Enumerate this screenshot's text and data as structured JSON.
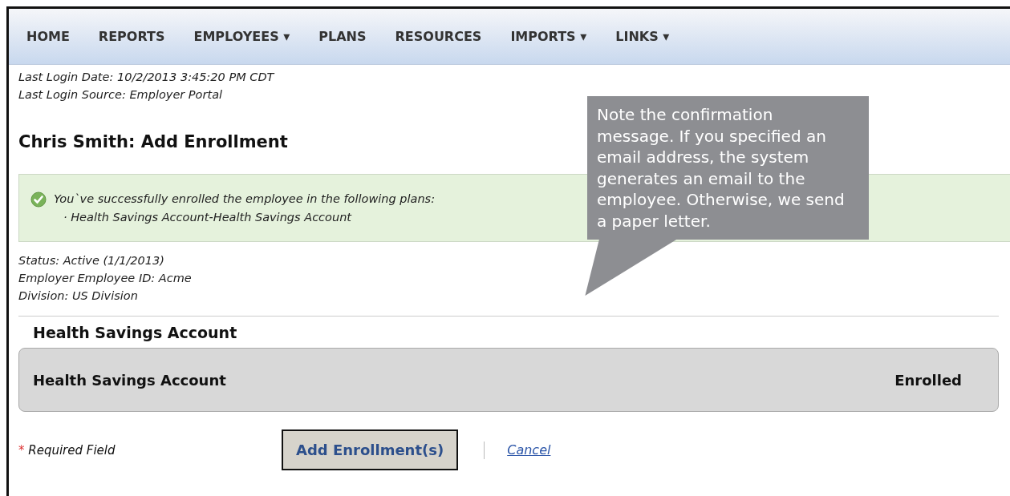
{
  "nav": [
    {
      "label": "HOME"
    },
    {
      "label": "REPORTS"
    },
    {
      "label": "EMPLOYEES",
      "arrow": "▾"
    },
    {
      "label": "PLANS"
    },
    {
      "label": "RESOURCES"
    },
    {
      "label": "IMPORTS",
      "arrow": "▾"
    },
    {
      "label": "LINKS",
      "arrow": "▾"
    }
  ],
  "login": [
    "Last Login Date: 10/2/2013 3:45:20 PM CDT",
    "Last Login Source: Employer Portal"
  ],
  "heading": "Chris Smith: Add Enrollment",
  "success": {
    "message": "You`ve successfully enrolled the employee in the following plans:",
    "items": [
      "· Health Savings Account-Health Savings Account"
    ]
  },
  "details": [
    "Status: Active (1/1/2013)",
    "Employer Employee ID: Acme",
    "Division: US Division"
  ],
  "section": {
    "title": "Health Savings Account",
    "plan": {
      "name": "Health Savings Account",
      "status": "Enrolled"
    }
  },
  "footer": {
    "required_mark": "*",
    "required_label": "Required Field",
    "button": "Add Enrollment(s)",
    "link": "Cancel"
  },
  "callout": {
    "text": "Note the confirmation message. If you specified an email address, the system generates an email to the employee. Otherwise, we send a paper letter."
  }
}
